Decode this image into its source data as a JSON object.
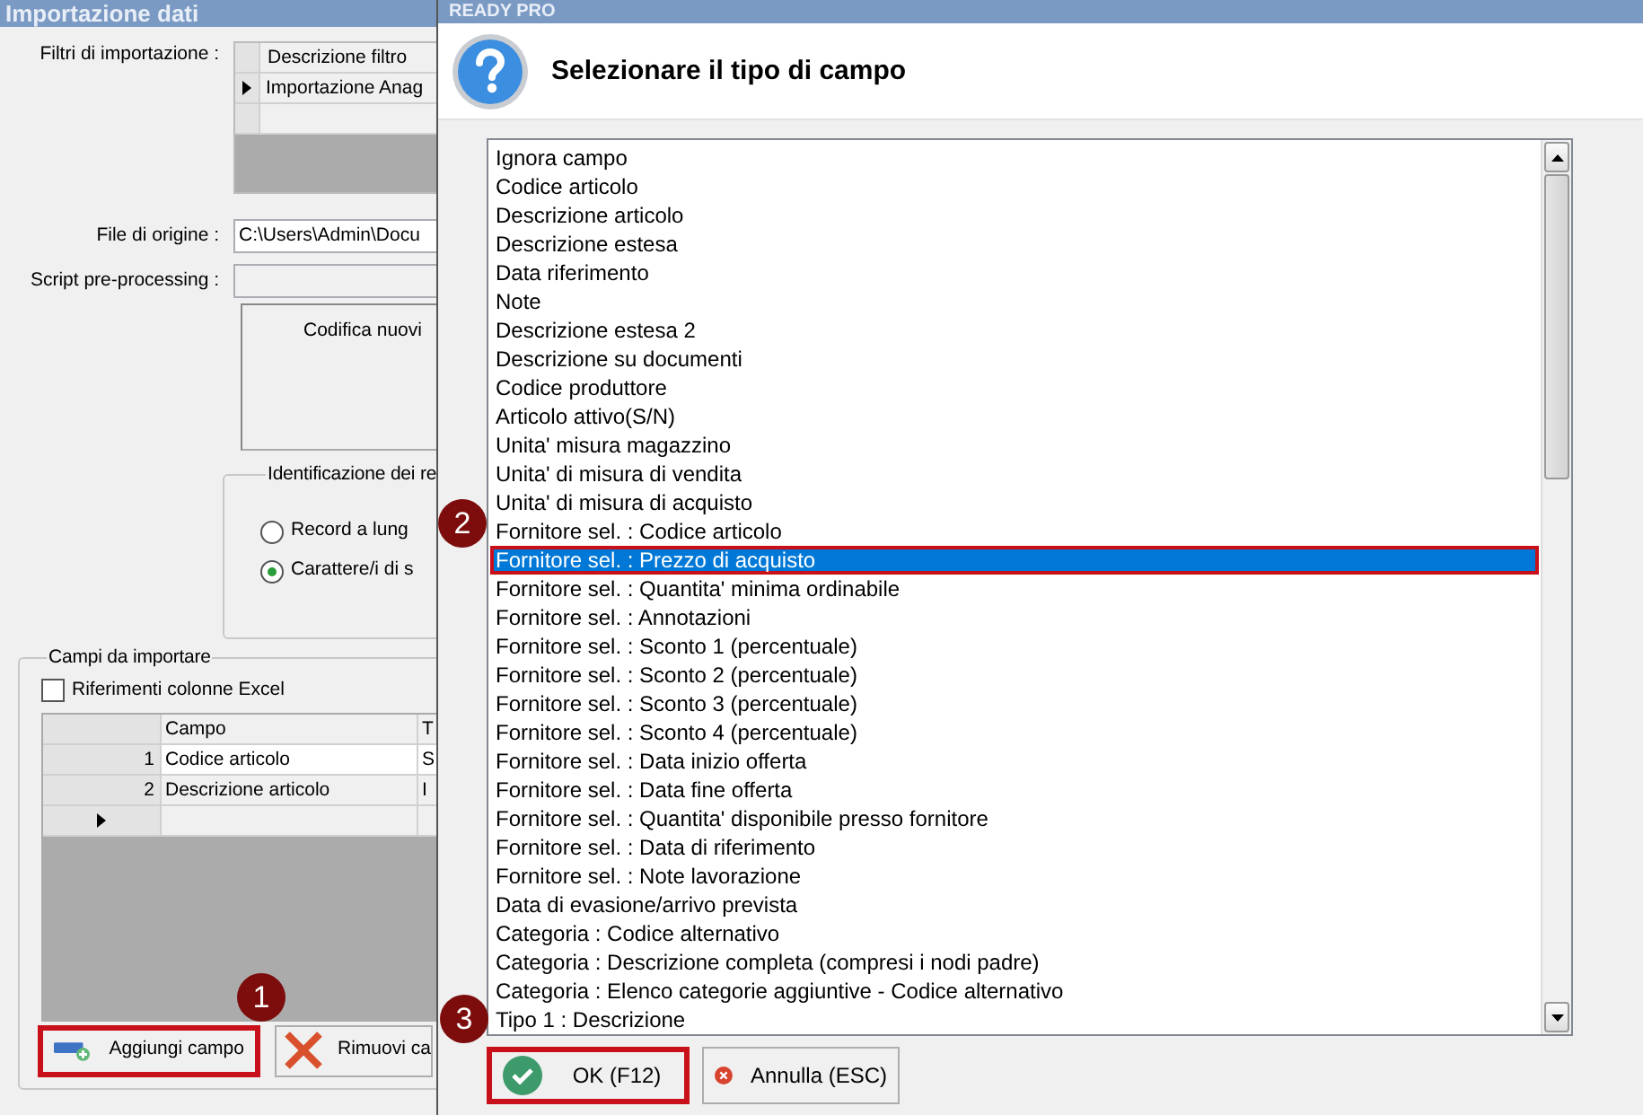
{
  "background_window": {
    "title": "Importazione dati",
    "filters": {
      "label": "Filtri di importazione :",
      "column": "Descrizione filtro",
      "rows": [
        {
          "text": "Importazione Anag",
          "current": true
        }
      ]
    },
    "source_file": {
      "label": "File di origine :",
      "value": "C:\\Users\\Admin\\Docu"
    },
    "script": {
      "label": "Script pre-processing :"
    },
    "encoding_text": "Codifica nuovi",
    "record_group": {
      "title": "Identificazione dei re",
      "options": [
        {
          "label": "Record a lung",
          "selected": false
        },
        {
          "label": "Carattere/i di s",
          "selected": true
        }
      ]
    },
    "fields_group": {
      "title": "Campi da importare",
      "excel_refs": {
        "label": "Riferimenti colonne Excel",
        "checked": false
      },
      "columns": [
        "Campo",
        "T"
      ],
      "rows": [
        {
          "number": "1",
          "cells": [
            "Codice articolo",
            "S"
          ],
          "selected": true
        },
        {
          "number": "2",
          "cells": [
            "Descrizione articolo",
            "I"
          ],
          "selected": false
        }
      ],
      "buttons": [
        {
          "label": "Aggiungi campo",
          "kind": "add",
          "highlighted": true,
          "callout": "1"
        },
        {
          "label": "Rimuovi ca",
          "kind": "remove",
          "highlighted": false
        }
      ]
    }
  },
  "dialog": {
    "title": "READY PRO",
    "prompt": "Selezionare il tipo di campo",
    "items": [
      {
        "label": "Ignora campo",
        "selected": false
      },
      {
        "label": "Codice articolo",
        "selected": false
      },
      {
        "label": "Descrizione articolo",
        "selected": false
      },
      {
        "label": "Descrizione estesa",
        "selected": false
      },
      {
        "label": "Data riferimento",
        "selected": false
      },
      {
        "label": "Note",
        "selected": false
      },
      {
        "label": "Descrizione estesa 2",
        "selected": false
      },
      {
        "label": "Descrizione su documenti",
        "selected": false
      },
      {
        "label": "Codice produttore",
        "selected": false
      },
      {
        "label": "Articolo attivo(S/N)",
        "selected": false
      },
      {
        "label": "Unita' misura magazzino",
        "selected": false
      },
      {
        "label": "Unita' di misura di vendita",
        "selected": false
      },
      {
        "label": "Unita' di misura di acquisto",
        "selected": false
      },
      {
        "label": "Fornitore sel. : Codice articolo",
        "selected": false
      },
      {
        "label": "Fornitore sel. : Prezzo di acquisto",
        "selected": true,
        "callout": "2"
      },
      {
        "label": "Fornitore sel. : Quantita' minima ordinabile",
        "selected": false
      },
      {
        "label": "Fornitore sel. : Annotazioni",
        "selected": false
      },
      {
        "label": "Fornitore sel. : Sconto 1 (percentuale)",
        "selected": false
      },
      {
        "label": "Fornitore sel. : Sconto 2 (percentuale)",
        "selected": false
      },
      {
        "label": "Fornitore sel. : Sconto 3 (percentuale)",
        "selected": false
      },
      {
        "label": "Fornitore sel. : Sconto 4 (percentuale)",
        "selected": false
      },
      {
        "label": "Fornitore sel. : Data inizio offerta",
        "selected": false
      },
      {
        "label": "Fornitore sel. : Data fine offerta",
        "selected": false
      },
      {
        "label": "Fornitore sel. : Quantita' disponibile presso fornitore",
        "selected": false
      },
      {
        "label": "Fornitore sel. : Data di riferimento",
        "selected": false
      },
      {
        "label": "Fornitore sel. : Note lavorazione",
        "selected": false
      },
      {
        "label": "Data di evasione/arrivo prevista",
        "selected": false
      },
      {
        "label": "Categoria : Codice alternativo",
        "selected": false
      },
      {
        "label": "Categoria : Descrizione completa (compresi i nodi padre)",
        "selected": false
      },
      {
        "label": "Categoria : Elenco categorie aggiuntive - Codice alternativo",
        "selected": false
      },
      {
        "label": "Tipo 1 : Descrizione",
        "selected": false
      }
    ],
    "buttons": [
      {
        "label": "OK (F12)",
        "kind": "ok",
        "highlighted": true,
        "callout": "3"
      },
      {
        "label": "Annulla (ESC)",
        "kind": "cancel",
        "highlighted": false
      }
    ]
  }
}
